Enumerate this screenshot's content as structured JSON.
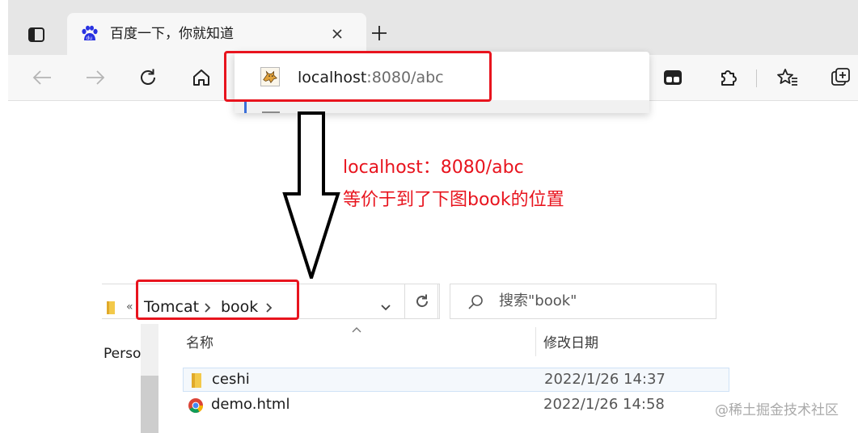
{
  "browser": {
    "tab": {
      "title": "百度一下，你就知道",
      "favicon": "baidu-paw-icon"
    },
    "address_suggestion": {
      "host": "localhost",
      "path": ":8080/abc",
      "icon": "tomcat-icon"
    },
    "toolbar_icons": [
      "back-arrow-icon",
      "forward-arrow-icon",
      "refresh-icon",
      "home-icon",
      "collections-icon",
      "extensions-icon",
      "favorites-icon",
      "add-tab-group-icon"
    ]
  },
  "annotation": {
    "line1": "localhost：8080/abc",
    "line2": "等价于到了下图book的位置",
    "color": "#e8141e"
  },
  "explorer": {
    "breadcrumb_overflow": "«",
    "breadcrumb": [
      "Tomcat",
      "book"
    ],
    "search_placeholder": "搜索\"book\"",
    "nav_label": "Perso",
    "columns": {
      "name": "名称",
      "date": "修改日期"
    },
    "files": [
      {
        "name": "ceshi",
        "date": "2022/1/26 14:37",
        "icon": "folder-icon"
      },
      {
        "name": "demo.html",
        "date": "2022/1/26 14:58",
        "icon": "chrome-icon"
      }
    ]
  },
  "watermark": "@稀土掘金技术社区"
}
